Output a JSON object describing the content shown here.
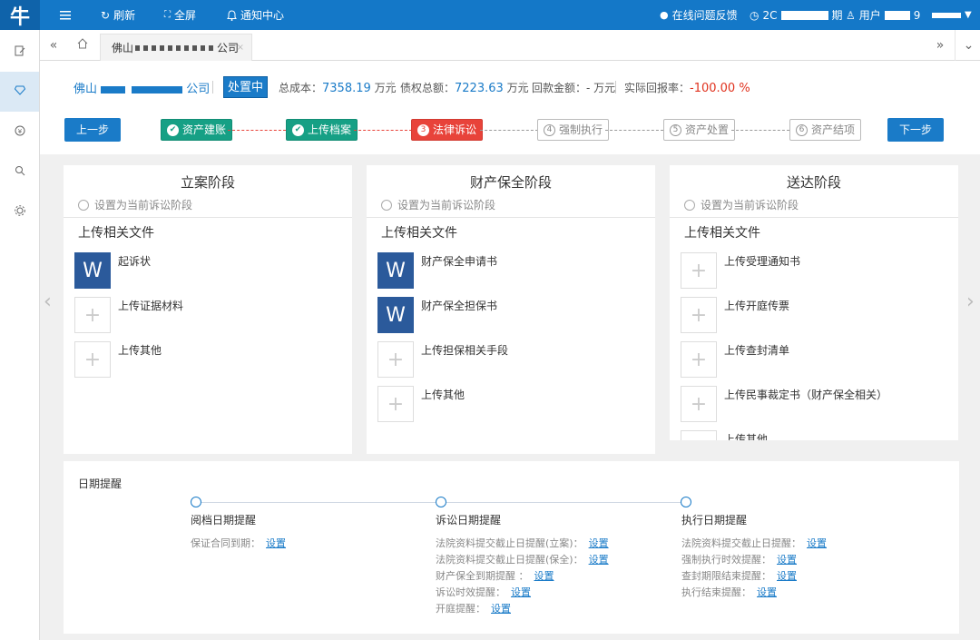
{
  "topbar": {
    "logo": "牛",
    "refresh_label": "刷新",
    "fullscreen_label": "全屏",
    "notify_label": "通知中心",
    "feedback_label": "在线问题反馈",
    "date_prefix": "2C",
    "date_suffix": "期",
    "user_prefix": "用户",
    "user_suffix": "9"
  },
  "tabbar": {
    "tab_label": "佛山",
    "tab_suffix": "公司"
  },
  "info": {
    "company_prefix": "佛山",
    "company_suffix": "公司",
    "status": "处置中",
    "total_cost_label": "总成本：",
    "total_cost": "7358.19",
    "total_cost_unit": "万元",
    "claim_label": "债权总额：",
    "claim": "7223.63",
    "claim_unit": "万元",
    "payback_label": "回款金额：",
    "payback": "- 万元",
    "return_label": "实际回报率：",
    "return": "-100.00 %"
  },
  "steps": {
    "prev": "上一步",
    "next": "下一步",
    "items": [
      {
        "num": "✔",
        "label": "资产建账"
      },
      {
        "num": "✔",
        "label": "上传档案"
      },
      {
        "num": "3",
        "label": "法律诉讼"
      },
      {
        "num": "4",
        "label": "强制执行"
      },
      {
        "num": "5",
        "label": "资产处置"
      },
      {
        "num": "6",
        "label": "资产结项"
      }
    ]
  },
  "panels": [
    {
      "title": "立案阶段",
      "radio": "设置为当前诉讼阶段",
      "upload": "上传相关文件",
      "files": [
        "起诉状",
        "上传证据材料",
        "上传其他"
      ]
    },
    {
      "title": "财产保全阶段",
      "radio": "设置为当前诉讼阶段",
      "upload": "上传相关文件",
      "files": [
        "财产保全申请书",
        "财产保全担保书",
        "上传担保相关手段",
        "上传其他"
      ]
    },
    {
      "title": "送达阶段",
      "radio": "设置为当前诉讼阶段",
      "upload": "上传相关文件",
      "files": [
        "上传受理通知书",
        "上传开庭传票",
        "上传查封清单",
        "上传民事裁定书（财产保全相关）",
        "上传其他"
      ]
    }
  ],
  "dates": {
    "title": "日期提醒",
    "set": "设置",
    "groups": [
      {
        "title": "阅档日期提醒",
        "rows": [
          "保证合同到期："
        ]
      },
      {
        "title": "诉讼日期提醒",
        "rows": [
          "法院资料提交截止日提醒(立案)：",
          "法院资料提交截止日提醒(保全)：",
          "财产保全到期提醒 ：",
          "诉讼时效提醒：",
          "开庭提醒："
        ]
      },
      {
        "title": "执行日期提醒",
        "rows": [
          "法院资料提交截止日提醒：",
          "强制执行时效提醒：",
          "查封期限结束提醒：",
          "执行结束提醒："
        ]
      }
    ]
  }
}
